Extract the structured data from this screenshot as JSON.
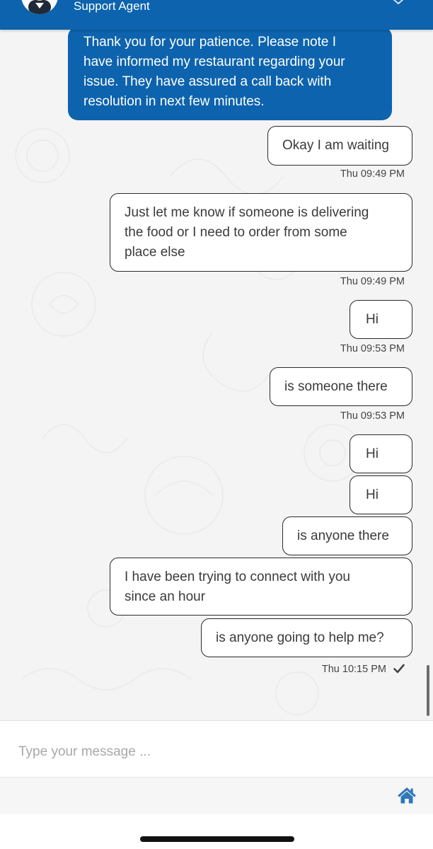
{
  "header": {
    "title": "Support Agent",
    "avatar_icon": "user-avatar-icon",
    "menu_icon": "more-icon",
    "accent_color": "#0d63ad"
  },
  "messages": {
    "incoming_1": {
      "lines": [
        "Thank you for your patience. Please note I",
        "have informed my restaurant regarding your",
        "issue. They have assured a call back with",
        "resolution in next few minutes."
      ]
    },
    "outgoing": [
      {
        "lines": [
          "Okay I am waiting"
        ],
        "time": "Thu 09:49 PM"
      },
      {
        "lines": [
          "Just let me know if someone is delivering",
          "the food or I need to order from some",
          "place else"
        ],
        "time": "Thu 09:49 PM"
      },
      {
        "lines": [
          "Hi"
        ],
        "time": "Thu 09:53 PM"
      },
      {
        "lines": [
          "is someone there"
        ],
        "time": "Thu 09:53 PM"
      },
      {
        "lines": [
          "Hi"
        ],
        "time": ""
      },
      {
        "lines": [
          "Hi"
        ],
        "time": ""
      },
      {
        "lines": [
          "is anyone there"
        ],
        "time": ""
      },
      {
        "lines": [
          "I have been trying to connect with you",
          "since an hour"
        ],
        "time": ""
      },
      {
        "lines": [
          "is anyone going to help me?"
        ],
        "time": "Thu 10:15 PM"
      }
    ],
    "delivered_icon": "check-icon"
  },
  "composer": {
    "placeholder": "Type your message ...",
    "value": ""
  },
  "toolbar": {
    "home_icon": "home-icon",
    "home_color": "#2f78b8"
  }
}
